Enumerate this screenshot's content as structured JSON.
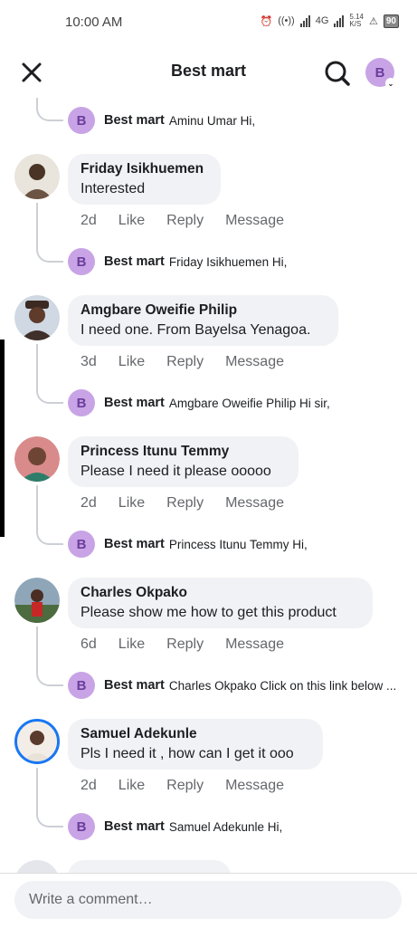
{
  "status": {
    "time": "10:00 AM",
    "network": "4G",
    "speed": "5.14\nK/S",
    "battery": "90"
  },
  "header": {
    "title": "Best mart",
    "avatar_letter": "B"
  },
  "colors": {
    "bubble": "#f0f2f5",
    "meta": "#65676b",
    "page_avatar": "#c8a4e6"
  },
  "actions": {
    "like": "Like",
    "reply": "Reply",
    "message": "Message"
  },
  "top_reply": {
    "author": "Best mart",
    "text": "Aminu Umar Hi,"
  },
  "comments": [
    {
      "author": "Friday Isikhuemen",
      "text": "Interested",
      "age": "2d",
      "reply_author": "Best mart",
      "reply_text": "Friday Isikhuemen Hi,"
    },
    {
      "author": "Amgbare Oweifie Philip",
      "text": "I need one. From Bayelsa Yenagoa.",
      "age": "3d",
      "reply_author": "Best mart",
      "reply_text": "Amgbare Oweifie Philip  Hi sir,"
    },
    {
      "author": "Princess Itunu Temmy",
      "text": "Please I need it please ooooo",
      "age": "2d",
      "reply_author": "Best mart",
      "reply_text": "Princess Itunu Temmy Hi,"
    },
    {
      "author": "Charles Okpako",
      "text": "Please show me how to get this product",
      "age": "6d",
      "reply_author": "Best mart",
      "reply_text": "Charles Okpako Click on this link below ..."
    },
    {
      "author": "Samuel Adekunle",
      "text": "Pls I need it , how can I get it ooo",
      "age": "2d",
      "reply_author": "Best mart",
      "reply_text": "Samuel Adekunle Hi,"
    }
  ],
  "composer": {
    "placeholder": "Write a comment…"
  }
}
